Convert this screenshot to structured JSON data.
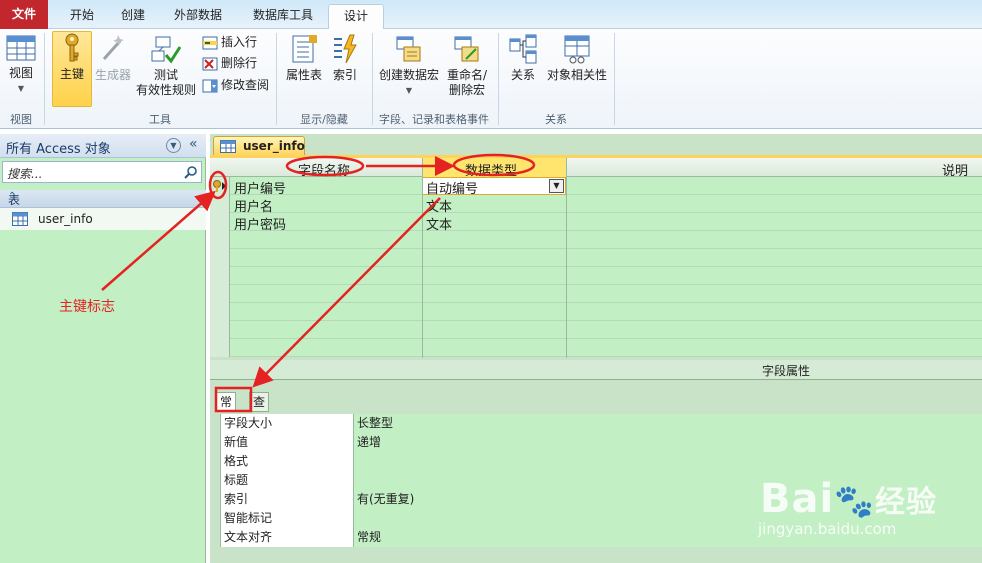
{
  "ribbon": {
    "tabs": [
      "文件",
      "开始",
      "创建",
      "外部数据",
      "数据库工具",
      "设计"
    ],
    "buttons": {
      "view": "视图",
      "primary_key": "主键",
      "builder": "生成器",
      "test_line1": "测试",
      "test_line2": "有效性规则",
      "insert_row": "插入行",
      "delete_row": "删除行",
      "modify_lookup": "修改查阅",
      "property_sheet": "属性表",
      "indexes": "索引",
      "create_macro": "创建数据宏",
      "rename_line1": "重命名/",
      "rename_line2": "删除宏",
      "relationships": "关系",
      "dependencies": "对象相关性"
    },
    "groups": {
      "views": "视图",
      "tools": "工具",
      "show_hide": "显示/隐藏",
      "field_events": "字段、记录和表格事件",
      "relationships": "关系"
    }
  },
  "nav": {
    "title": "所有 Access 对象",
    "search_placeholder": "搜索...",
    "group": "表",
    "items": [
      "user_info"
    ]
  },
  "document": {
    "tab": "user_info",
    "columns": {
      "field_name": "字段名称",
      "data_type": "数据类型",
      "description": "说明"
    },
    "rows": [
      {
        "field": "用户编号",
        "type": "自动编号"
      },
      {
        "field": "用户名",
        "type": "文本"
      },
      {
        "field": "用户密码",
        "type": "文本"
      }
    ],
    "field_properties_title": "字段属性",
    "property_tabs": [
      "常规",
      "查阅"
    ],
    "properties": [
      {
        "name": "字段大小",
        "value": "长整型"
      },
      {
        "name": "新值",
        "value": "递增"
      },
      {
        "name": "格式",
        "value": ""
      },
      {
        "name": "标题",
        "value": ""
      },
      {
        "name": "索引",
        "value": "有(无重复)"
      },
      {
        "name": "智能标记",
        "value": ""
      },
      {
        "name": "文本对齐",
        "value": "常规"
      }
    ]
  },
  "annotations": {
    "primary_key_label": "主键标志"
  },
  "watermark": {
    "brand": "Bai",
    "brand_tail": "经验",
    "url": "jingyan.baidu.com"
  },
  "colors": {
    "file_tab": "#c1272d",
    "grid_green": "#c2efc4",
    "annotation_red": "#e52222",
    "active_yellow": "#ffd24a"
  }
}
